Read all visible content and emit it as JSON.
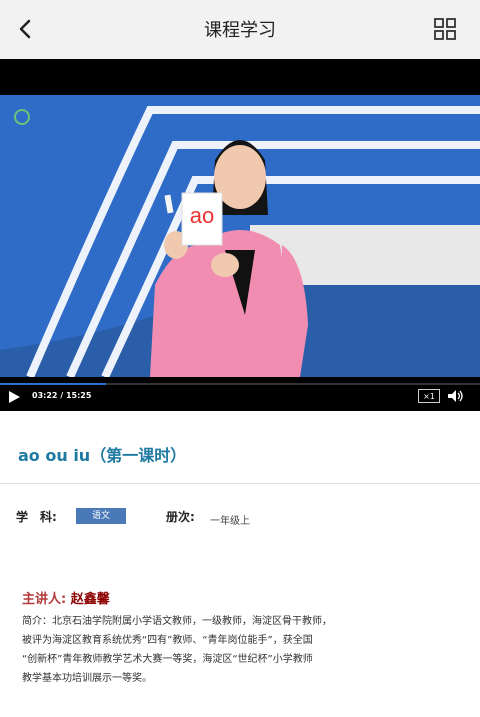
{
  "header": {
    "title": "课程学习",
    "back_icon": "chevron-left-icon",
    "menu_icon": "grid-icon"
  },
  "video": {
    "card_text": "ao",
    "time": "03:22 / 15:25",
    "progress": 0.22,
    "speed": "×1",
    "colors": {
      "stage": "#2d66c3",
      "progress": "#2a73d6",
      "jacket": "#f28db2"
    }
  },
  "course": {
    "title": "ao ou iu（第一课时）"
  },
  "meta": {
    "subject_label": "学　科:",
    "subject": "语文",
    "volume_label": "册次:",
    "volume": "一年级上"
  },
  "lecturer": {
    "label": "主讲人:",
    "name": "赵鑫馨"
  },
  "bio": [
    "简介：北京石油学院附属小学语文教师，一级教师，海淀区骨干教师，",
    "被评为海淀区教育系统优秀“四有”教师、“青年岗位能手”，获全国",
    "“创新杯”青年教师教学艺术大赛一等奖，海淀区“世纪杯”小学教师",
    "教学基本功培训展示一等奖。"
  ]
}
